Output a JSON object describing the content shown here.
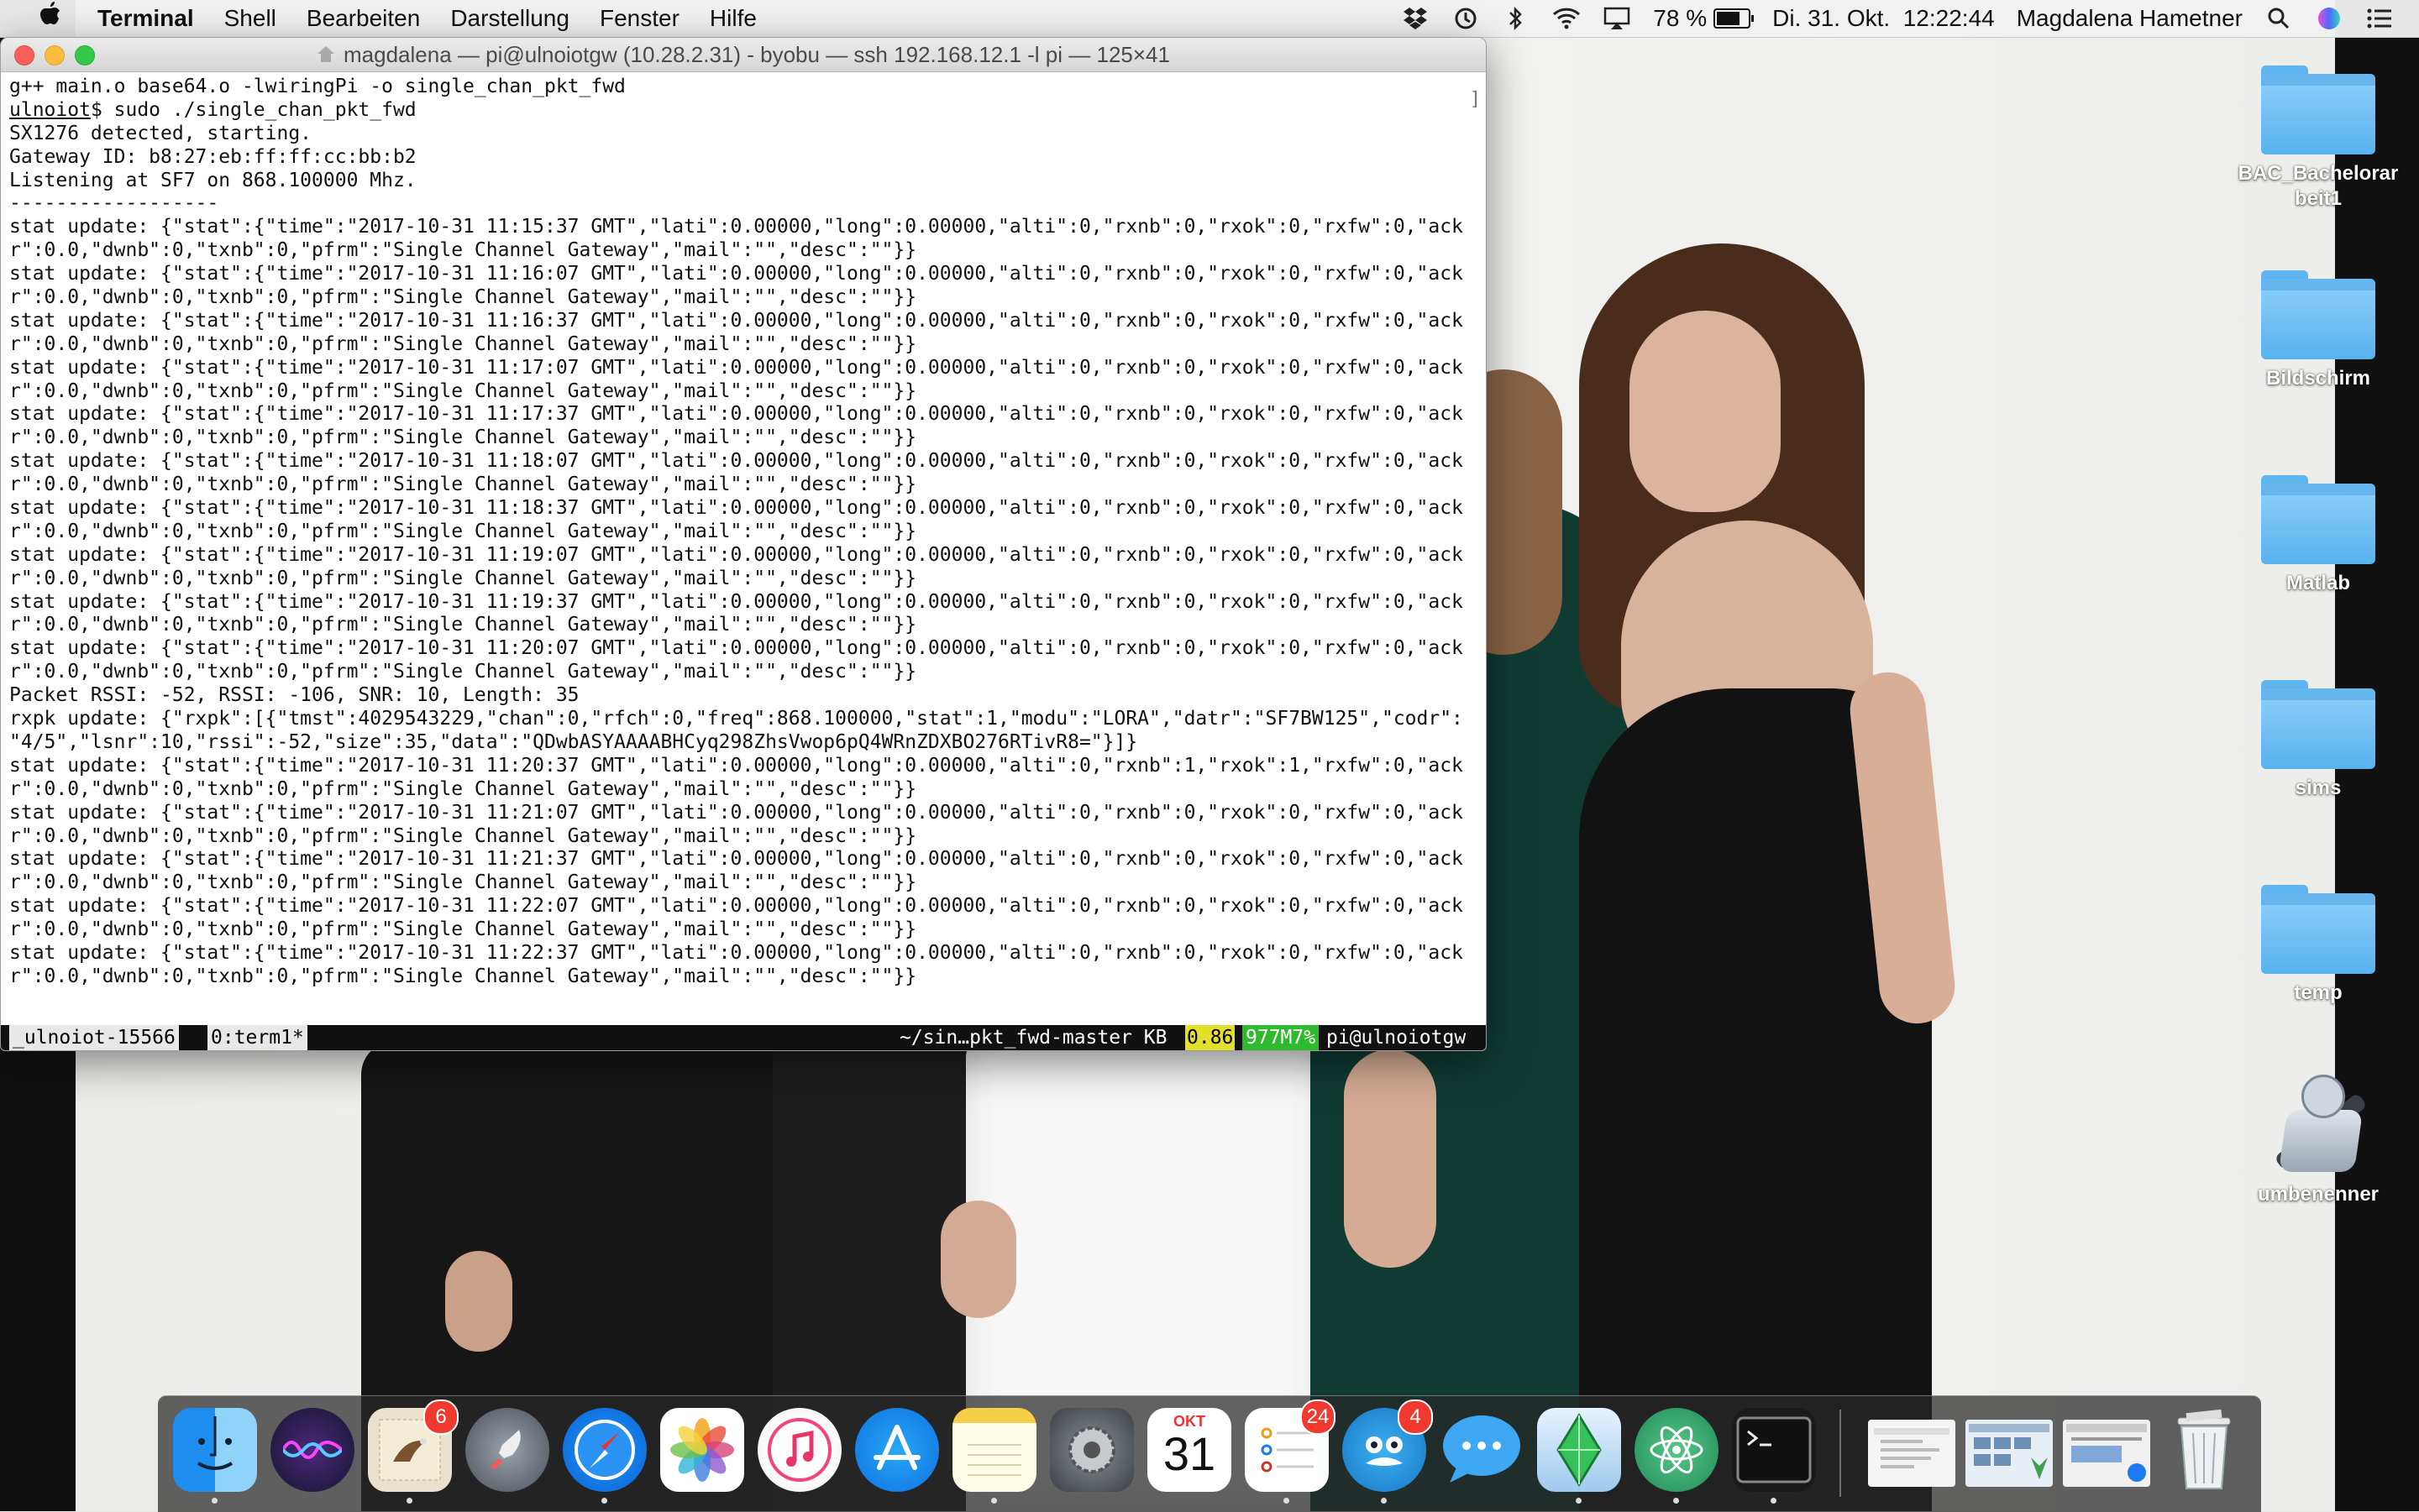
{
  "menubar": {
    "app_name": "Terminal",
    "items": [
      "Shell",
      "Bearbeiten",
      "Darstellung",
      "Fenster",
      "Hilfe"
    ],
    "battery_percent": "78 %",
    "battery_level": 0.78,
    "datetime": "Di. 31. Okt.  12:22:44",
    "user": "Magdalena Hametner",
    "status_icons": [
      "dropbox-icon",
      "time-machine-icon",
      "bluetooth-icon",
      "wifi-icon",
      "airplay-icon"
    ]
  },
  "terminal": {
    "title": "magdalena — pi@ulnoiotgw (10.28.2.31) - byobu — ssh 192.168.12.1 -l pi — 125×41",
    "lines": [
      "g++ main.o base64.o -lwiringPi -o single_chan_pkt_fwd",
      "ulnoiot$ sudo ./single_chan_pkt_fwd",
      "SX1276 detected, starting.",
      "Gateway ID: b8:27:eb:ff:ff:cc:bb:b2",
      "Listening at SF7 on 868.100000 Mhz.",
      "------------------",
      "stat update: {\"stat\":{\"time\":\"2017-10-31 11:15:37 GMT\",\"lati\":0.00000,\"long\":0.00000,\"alti\":0,\"rxnb\":0,\"rxok\":0,\"rxfw\":0,\"ack",
      "r\":0.0,\"dwnb\":0,\"txnb\":0,\"pfrm\":\"Single Channel Gateway\",\"mail\":\"\",\"desc\":\"\"}}",
      "stat update: {\"stat\":{\"time\":\"2017-10-31 11:16:07 GMT\",\"lati\":0.00000,\"long\":0.00000,\"alti\":0,\"rxnb\":0,\"rxok\":0,\"rxfw\":0,\"ack",
      "r\":0.0,\"dwnb\":0,\"txnb\":0,\"pfrm\":\"Single Channel Gateway\",\"mail\":\"\",\"desc\":\"\"}}",
      "stat update: {\"stat\":{\"time\":\"2017-10-31 11:16:37 GMT\",\"lati\":0.00000,\"long\":0.00000,\"alti\":0,\"rxnb\":0,\"rxok\":0,\"rxfw\":0,\"ack",
      "r\":0.0,\"dwnb\":0,\"txnb\":0,\"pfrm\":\"Single Channel Gateway\",\"mail\":\"\",\"desc\":\"\"}}",
      "stat update: {\"stat\":{\"time\":\"2017-10-31 11:17:07 GMT\",\"lati\":0.00000,\"long\":0.00000,\"alti\":0,\"rxnb\":0,\"rxok\":0,\"rxfw\":0,\"ack",
      "r\":0.0,\"dwnb\":0,\"txnb\":0,\"pfrm\":\"Single Channel Gateway\",\"mail\":\"\",\"desc\":\"\"}}",
      "stat update: {\"stat\":{\"time\":\"2017-10-31 11:17:37 GMT\",\"lati\":0.00000,\"long\":0.00000,\"alti\":0,\"rxnb\":0,\"rxok\":0,\"rxfw\":0,\"ack",
      "r\":0.0,\"dwnb\":0,\"txnb\":0,\"pfrm\":\"Single Channel Gateway\",\"mail\":\"\",\"desc\":\"\"}}",
      "stat update: {\"stat\":{\"time\":\"2017-10-31 11:18:07 GMT\",\"lati\":0.00000,\"long\":0.00000,\"alti\":0,\"rxnb\":0,\"rxok\":0,\"rxfw\":0,\"ack",
      "r\":0.0,\"dwnb\":0,\"txnb\":0,\"pfrm\":\"Single Channel Gateway\",\"mail\":\"\",\"desc\":\"\"}}",
      "stat update: {\"stat\":{\"time\":\"2017-10-31 11:18:37 GMT\",\"lati\":0.00000,\"long\":0.00000,\"alti\":0,\"rxnb\":0,\"rxok\":0,\"rxfw\":0,\"ack",
      "r\":0.0,\"dwnb\":0,\"txnb\":0,\"pfrm\":\"Single Channel Gateway\",\"mail\":\"\",\"desc\":\"\"}}",
      "stat update: {\"stat\":{\"time\":\"2017-10-31 11:19:07 GMT\",\"lati\":0.00000,\"long\":0.00000,\"alti\":0,\"rxnb\":0,\"rxok\":0,\"rxfw\":0,\"ack",
      "r\":0.0,\"dwnb\":0,\"txnb\":0,\"pfrm\":\"Single Channel Gateway\",\"mail\":\"\",\"desc\":\"\"}}",
      "stat update: {\"stat\":{\"time\":\"2017-10-31 11:19:37 GMT\",\"lati\":0.00000,\"long\":0.00000,\"alti\":0,\"rxnb\":0,\"rxok\":0,\"rxfw\":0,\"ack",
      "r\":0.0,\"dwnb\":0,\"txnb\":0,\"pfrm\":\"Single Channel Gateway\",\"mail\":\"\",\"desc\":\"\"}}",
      "stat update: {\"stat\":{\"time\":\"2017-10-31 11:20:07 GMT\",\"lati\":0.00000,\"long\":0.00000,\"alti\":0,\"rxnb\":0,\"rxok\":0,\"rxfw\":0,\"ack",
      "r\":0.0,\"dwnb\":0,\"txnb\":0,\"pfrm\":\"Single Channel Gateway\",\"mail\":\"\",\"desc\":\"\"}}",
      "Packet RSSI: -52, RSSI: -106, SNR: 10, Length: 35",
      "rxpk update: {\"rxpk\":[{\"tmst\":4029543229,\"chan\":0,\"rfch\":0,\"freq\":868.100000,\"stat\":1,\"modu\":\"LORA\",\"datr\":\"SF7BW125\",\"codr\":",
      "\"4/5\",\"lsnr\":10,\"rssi\":-52,\"size\":35,\"data\":\"QDwbASYAAAABHCyq298ZhsVwop6pQ4WRnZDXBO276RTivR8=\"}]}",
      "stat update: {\"stat\":{\"time\":\"2017-10-31 11:20:37 GMT\",\"lati\":0.00000,\"long\":0.00000,\"alti\":0,\"rxnb\":1,\"rxok\":1,\"rxfw\":0,\"ack",
      "r\":0.0,\"dwnb\":0,\"txnb\":0,\"pfrm\":\"Single Channel Gateway\",\"mail\":\"\",\"desc\":\"\"}}",
      "stat update: {\"stat\":{\"time\":\"2017-10-31 11:21:07 GMT\",\"lati\":0.00000,\"long\":0.00000,\"alti\":0,\"rxnb\":0,\"rxok\":0,\"rxfw\":0,\"ack",
      "r\":0.0,\"dwnb\":0,\"txnb\":0,\"pfrm\":\"Single Channel Gateway\",\"mail\":\"\",\"desc\":\"\"}}",
      "stat update: {\"stat\":{\"time\":\"2017-10-31 11:21:37 GMT\",\"lati\":0.00000,\"long\":0.00000,\"alti\":0,\"rxnb\":0,\"rxok\":0,\"rxfw\":0,\"ack",
      "r\":0.0,\"dwnb\":0,\"txnb\":0,\"pfrm\":\"Single Channel Gateway\",\"mail\":\"\",\"desc\":\"\"}}",
      "stat update: {\"stat\":{\"time\":\"2017-10-31 11:22:07 GMT\",\"lati\":0.00000,\"long\":0.00000,\"alti\":0,\"rxnb\":0,\"rxok\":0,\"rxfw\":0,\"ack",
      "r\":0.0,\"dwnb\":0,\"txnb\":0,\"pfrm\":\"Single Channel Gateway\",\"mail\":\"\",\"desc\":\"\"}}",
      "stat update: {\"stat\":{\"time\":\"2017-10-31 11:22:37 GMT\",\"lati\":0.00000,\"long\":0.00000,\"alti\":0,\"rxnb\":0,\"rxok\":0,\"rxfw\":0,\"ack",
      "r\":0.0,\"dwnb\":0,\"txnb\":0,\"pfrm\":\"Single Channel Gateway\",\"mail\":\"\",\"desc\":\"\"}}"
    ],
    "statusbar": {
      "session": "_ulnoiot-15566",
      "window": "0:term1*",
      "path": "~/sin…pkt_fwd-master KB",
      "load": "0.86",
      "mem": "977M7%",
      "host": "pi@ulnoiotgw"
    }
  },
  "desktop": {
    "items": [
      {
        "label": "BAC_Bachelorarbeit1",
        "icon": "folder-icon"
      },
      {
        "label": "Bildschirm",
        "icon": "folder-icon"
      },
      {
        "label": "Matlab",
        "icon": "folder-icon"
      },
      {
        "label": "sims",
        "icon": "folder-icon"
      },
      {
        "label": "temp",
        "icon": "folder-icon"
      },
      {
        "label": "umbenenner",
        "icon": "automator-icon"
      }
    ]
  },
  "dock": {
    "apps": [
      {
        "name": "finder-icon",
        "badge": ""
      },
      {
        "name": "siri-icon",
        "badge": ""
      },
      {
        "name": "mail-icon",
        "badge": "6"
      },
      {
        "name": "launchpad-icon",
        "badge": ""
      },
      {
        "name": "safari-icon",
        "badge": ""
      },
      {
        "name": "photos-icon",
        "badge": ""
      },
      {
        "name": "itunes-icon",
        "badge": ""
      },
      {
        "name": "app-store-icon",
        "badge": ""
      },
      {
        "name": "notes-icon",
        "badge": ""
      },
      {
        "name": "system-preferences-icon",
        "badge": ""
      },
      {
        "name": "calendar-icon",
        "badge": ""
      },
      {
        "name": "reminders-icon",
        "badge": "24"
      },
      {
        "name": "tweetbot-icon",
        "badge": "4"
      },
      {
        "name": "messages-icon",
        "badge": ""
      },
      {
        "name": "the-sims-icon",
        "badge": ""
      },
      {
        "name": "atom-icon",
        "badge": ""
      },
      {
        "name": "terminal-icon",
        "badge": ""
      }
    ],
    "calendar_month": "OKT",
    "calendar_day": "31"
  },
  "colors": {
    "menubar_bg": "#f0f0f0",
    "terminal_bg": "#ffffff",
    "status_load": "#e4e02a",
    "status_mem": "#2dbb2d",
    "folder_blue": "#57b2ee",
    "badge_red": "#f0392f"
  }
}
